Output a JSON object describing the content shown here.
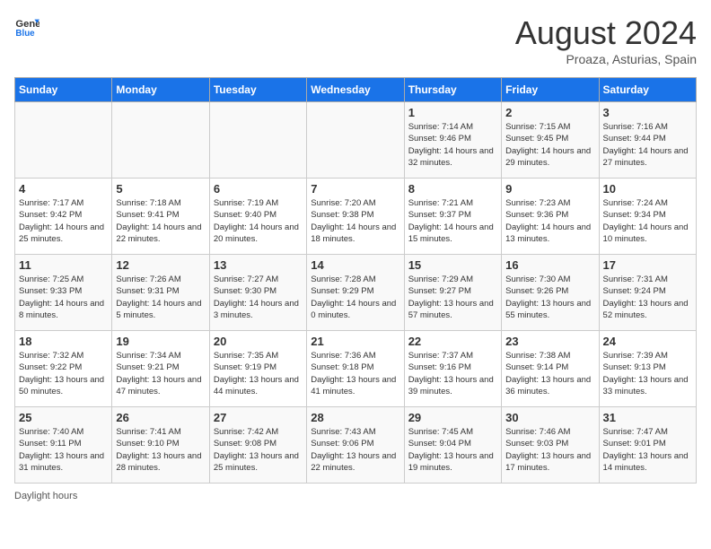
{
  "header": {
    "logo_line1": "General",
    "logo_line2": "Blue",
    "title": "August 2024",
    "subtitle": "Proaza, Asturias, Spain"
  },
  "days_of_week": [
    "Sunday",
    "Monday",
    "Tuesday",
    "Wednesday",
    "Thursday",
    "Friday",
    "Saturday"
  ],
  "weeks": [
    [
      {
        "day": "",
        "info": ""
      },
      {
        "day": "",
        "info": ""
      },
      {
        "day": "",
        "info": ""
      },
      {
        "day": "",
        "info": ""
      },
      {
        "day": "1",
        "info": "Sunrise: 7:14 AM\nSunset: 9:46 PM\nDaylight: 14 hours\nand 32 minutes."
      },
      {
        "day": "2",
        "info": "Sunrise: 7:15 AM\nSunset: 9:45 PM\nDaylight: 14 hours\nand 29 minutes."
      },
      {
        "day": "3",
        "info": "Sunrise: 7:16 AM\nSunset: 9:44 PM\nDaylight: 14 hours\nand 27 minutes."
      }
    ],
    [
      {
        "day": "4",
        "info": "Sunrise: 7:17 AM\nSunset: 9:42 PM\nDaylight: 14 hours\nand 25 minutes."
      },
      {
        "day": "5",
        "info": "Sunrise: 7:18 AM\nSunset: 9:41 PM\nDaylight: 14 hours\nand 22 minutes."
      },
      {
        "day": "6",
        "info": "Sunrise: 7:19 AM\nSunset: 9:40 PM\nDaylight: 14 hours\nand 20 minutes."
      },
      {
        "day": "7",
        "info": "Sunrise: 7:20 AM\nSunset: 9:38 PM\nDaylight: 14 hours\nand 18 minutes."
      },
      {
        "day": "8",
        "info": "Sunrise: 7:21 AM\nSunset: 9:37 PM\nDaylight: 14 hours\nand 15 minutes."
      },
      {
        "day": "9",
        "info": "Sunrise: 7:23 AM\nSunset: 9:36 PM\nDaylight: 14 hours\nand 13 minutes."
      },
      {
        "day": "10",
        "info": "Sunrise: 7:24 AM\nSunset: 9:34 PM\nDaylight: 14 hours\nand 10 minutes."
      }
    ],
    [
      {
        "day": "11",
        "info": "Sunrise: 7:25 AM\nSunset: 9:33 PM\nDaylight: 14 hours\nand 8 minutes."
      },
      {
        "day": "12",
        "info": "Sunrise: 7:26 AM\nSunset: 9:31 PM\nDaylight: 14 hours\nand 5 minutes."
      },
      {
        "day": "13",
        "info": "Sunrise: 7:27 AM\nSunset: 9:30 PM\nDaylight: 14 hours\nand 3 minutes."
      },
      {
        "day": "14",
        "info": "Sunrise: 7:28 AM\nSunset: 9:29 PM\nDaylight: 14 hours\nand 0 minutes."
      },
      {
        "day": "15",
        "info": "Sunrise: 7:29 AM\nSunset: 9:27 PM\nDaylight: 13 hours\nand 57 minutes."
      },
      {
        "day": "16",
        "info": "Sunrise: 7:30 AM\nSunset: 9:26 PM\nDaylight: 13 hours\nand 55 minutes."
      },
      {
        "day": "17",
        "info": "Sunrise: 7:31 AM\nSunset: 9:24 PM\nDaylight: 13 hours\nand 52 minutes."
      }
    ],
    [
      {
        "day": "18",
        "info": "Sunrise: 7:32 AM\nSunset: 9:22 PM\nDaylight: 13 hours\nand 50 minutes."
      },
      {
        "day": "19",
        "info": "Sunrise: 7:34 AM\nSunset: 9:21 PM\nDaylight: 13 hours\nand 47 minutes."
      },
      {
        "day": "20",
        "info": "Sunrise: 7:35 AM\nSunset: 9:19 PM\nDaylight: 13 hours\nand 44 minutes."
      },
      {
        "day": "21",
        "info": "Sunrise: 7:36 AM\nSunset: 9:18 PM\nDaylight: 13 hours\nand 41 minutes."
      },
      {
        "day": "22",
        "info": "Sunrise: 7:37 AM\nSunset: 9:16 PM\nDaylight: 13 hours\nand 39 minutes."
      },
      {
        "day": "23",
        "info": "Sunrise: 7:38 AM\nSunset: 9:14 PM\nDaylight: 13 hours\nand 36 minutes."
      },
      {
        "day": "24",
        "info": "Sunrise: 7:39 AM\nSunset: 9:13 PM\nDaylight: 13 hours\nand 33 minutes."
      }
    ],
    [
      {
        "day": "25",
        "info": "Sunrise: 7:40 AM\nSunset: 9:11 PM\nDaylight: 13 hours\nand 31 minutes."
      },
      {
        "day": "26",
        "info": "Sunrise: 7:41 AM\nSunset: 9:10 PM\nDaylight: 13 hours\nand 28 minutes."
      },
      {
        "day": "27",
        "info": "Sunrise: 7:42 AM\nSunset: 9:08 PM\nDaylight: 13 hours\nand 25 minutes."
      },
      {
        "day": "28",
        "info": "Sunrise: 7:43 AM\nSunset: 9:06 PM\nDaylight: 13 hours\nand 22 minutes."
      },
      {
        "day": "29",
        "info": "Sunrise: 7:45 AM\nSunset: 9:04 PM\nDaylight: 13 hours\nand 19 minutes."
      },
      {
        "day": "30",
        "info": "Sunrise: 7:46 AM\nSunset: 9:03 PM\nDaylight: 13 hours\nand 17 minutes."
      },
      {
        "day": "31",
        "info": "Sunrise: 7:47 AM\nSunset: 9:01 PM\nDaylight: 13 hours\nand 14 minutes."
      }
    ]
  ],
  "footer": {
    "daylight_label": "Daylight hours"
  }
}
